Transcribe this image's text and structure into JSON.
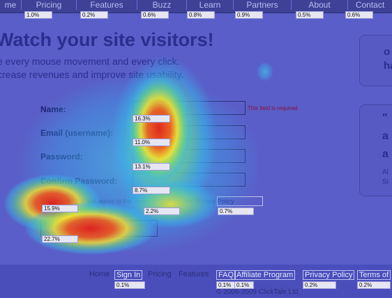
{
  "nav": [
    {
      "label": "me",
      "pct": "1.0%"
    },
    {
      "label": "Pricing",
      "pct": "0.2%"
    },
    {
      "label": "Features",
      "pct": "0.6%"
    },
    {
      "label": "Buzz",
      "pct": "0.8%"
    },
    {
      "label": "Learn",
      "pct": "0.9%"
    },
    {
      "label": "Partners",
      "pct": "0.5%"
    },
    {
      "label": "About",
      "pct": "0.6%"
    },
    {
      "label": "Contact",
      "pct": ""
    }
  ],
  "hero": {
    "headline": "Watch your site visitors!",
    "line1": "e every mouse movement and every click.",
    "line2": "crease revenues and improve site usability."
  },
  "form": {
    "name_label": "Name:",
    "email_label": "Email (username):",
    "password_label": "Password:",
    "confirm_label": "Confirm Password:",
    "required_note": "This field is required.",
    "terms_text": "I have read and agree to the Terms of Use and the Privacy Policy",
    "submit_label": "Create New Account",
    "pct_name": "16.3%",
    "pct_email": "11.0%",
    "pct_password": "13.1%",
    "pct_confirm": "8.7%",
    "pct_checkbox": "15.9%",
    "pct_terms": "2.2%",
    "pct_privacy": "0.7%",
    "pct_submit": "22.7%"
  },
  "side": {
    "top": "o\nha",
    "quote": "\"\na\na",
    "small": "Al\nSi"
  },
  "footer": {
    "links": [
      {
        "label": "Home",
        "pct": ""
      },
      {
        "label": "Sign In",
        "pct": "0.1%"
      },
      {
        "label": "Pricing",
        "pct": ""
      },
      {
        "label": "Features",
        "pct": ""
      },
      {
        "label": "FAQ",
        "pct": "0.1%"
      },
      {
        "label": "Affiliate Program",
        "pct": "0.1%"
      },
      {
        "label": "Privacy Policy",
        "pct": "0.2%"
      },
      {
        "label": "Terms of",
        "pct": "0.2%"
      }
    ],
    "copyright": "© 2006-2009 ClickTale Ltd."
  },
  "colors": {
    "overlay": "#5a5ec8",
    "text": "#2a2f8e",
    "hot": "#e8231c",
    "warm": "#f5e625",
    "cool": "#3cc3e8"
  }
}
